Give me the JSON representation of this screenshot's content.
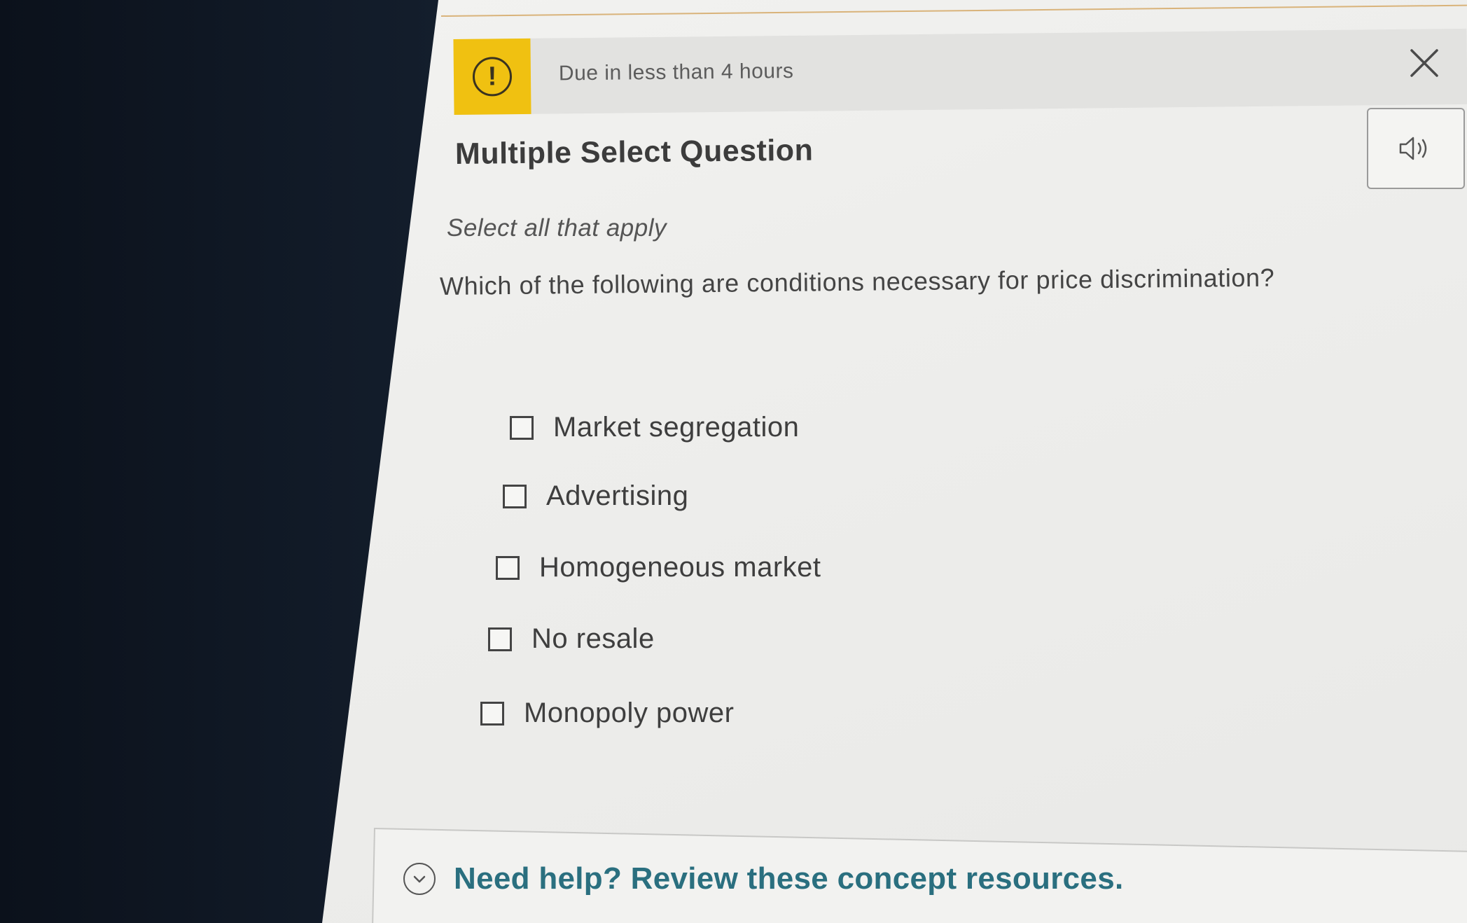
{
  "banner": {
    "due_text": "Due in less than 4 hours",
    "icon": "exclamation-circle-icon",
    "icon_glyph": "!",
    "accent_color": "#f0c111"
  },
  "header": {
    "close_icon": "close-icon",
    "audio_icon": "speaker-icon"
  },
  "question": {
    "type_title": "Multiple Select Question",
    "instruction": "Select all that apply",
    "prompt": "Which of the following are conditions necessary for price discrimination?",
    "options": [
      {
        "label": "Market segregation",
        "checked": false
      },
      {
        "label": "Advertising",
        "checked": false
      },
      {
        "label": "Homogeneous market",
        "checked": false
      },
      {
        "label": "No resale",
        "checked": false
      },
      {
        "label": "Monopoly power",
        "checked": false
      }
    ]
  },
  "help": {
    "label": "Need help? Review these concept resources.",
    "icon": "chevron-down-icon",
    "link_color": "#2a6f7f"
  }
}
